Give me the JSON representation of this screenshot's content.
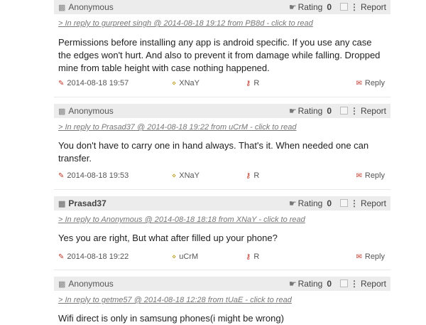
{
  "comments": [
    {
      "author": "Anonymous",
      "author_bold": false,
      "rating_label": "Rating",
      "rating_value": "0",
      "report_label": "Report",
      "reply_to": "> In reply to gurpreet singh @ 2014-08-18 19:12 from PB8d - click to read",
      "body": "Permissions before installing any app is android specific. If you use any case the edges won't hurt. And also to prevent it from damage while falling. Dropped mine from table height with case nothing happened.",
      "date": "2014-08-18 19:57",
      "user_tag": "XNaY",
      "letter": "R",
      "reply_label": "Reply"
    },
    {
      "author": "Anonymous",
      "author_bold": false,
      "rating_label": "Rating",
      "rating_value": "0",
      "report_label": "Report",
      "reply_to": "> In reply to Prasad37 @ 2014-08-18 19:22 from uCrM - click to read",
      "body": "You don't have to carry one in hand always. That's it. When needed one can transfer.",
      "date": "2014-08-18 19:53",
      "user_tag": "XNaY",
      "letter": "R",
      "reply_label": "Reply"
    },
    {
      "author": "Prasad37",
      "author_bold": true,
      "rating_label": "Rating",
      "rating_value": "0",
      "report_label": "Report",
      "reply_to": "> In reply to Anonymous @ 2014-08-18 18:18 from XNaY - click to read",
      "body": "Yes you are right, But what after filled up your phone?",
      "date": "2014-08-18 19:22",
      "user_tag": "uCrM",
      "letter": "R",
      "reply_label": "Reply"
    },
    {
      "author": "Anonymous",
      "author_bold": false,
      "rating_label": "Rating",
      "rating_value": "0",
      "report_label": "Report",
      "reply_to": "> In reply to getme57 @ 2014-08-18 12:28 from tUaE - click to read",
      "body": "Wifi direct is only in samsung phones(i might be wrong)"
    }
  ]
}
